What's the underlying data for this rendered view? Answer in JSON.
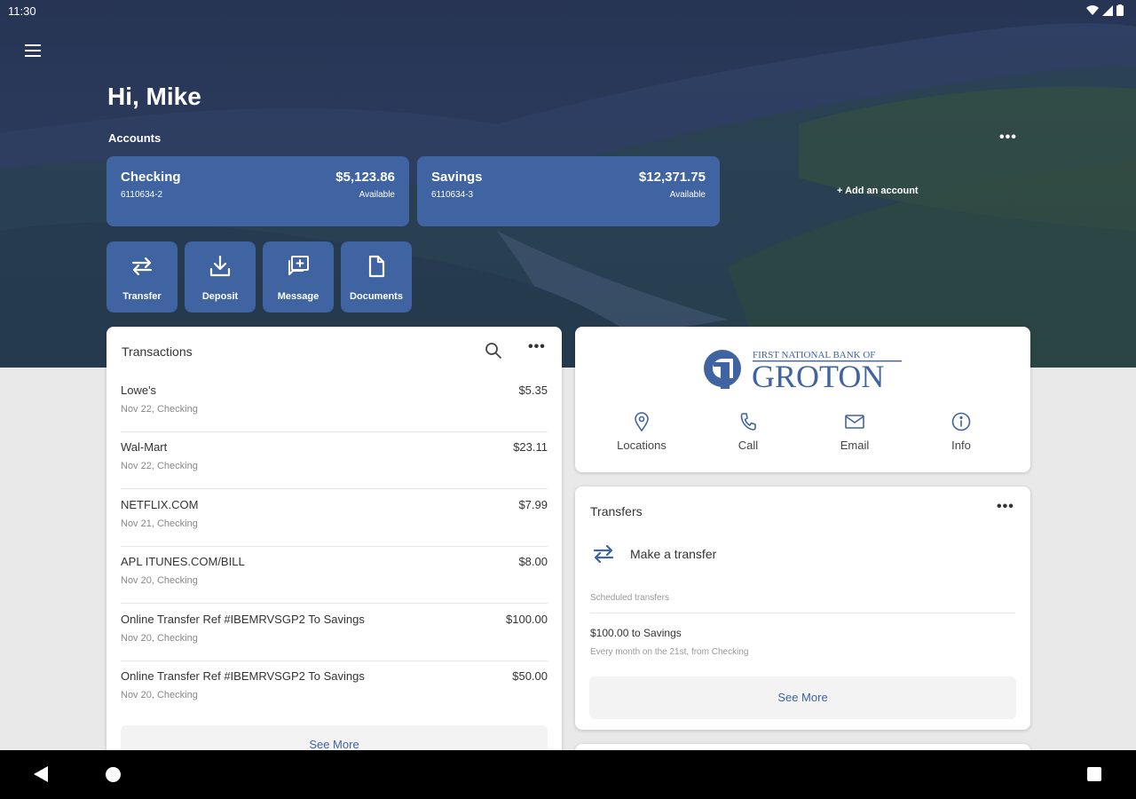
{
  "status_bar": {
    "time": "11:30"
  },
  "greeting": "Hi, Mike",
  "accounts": {
    "title": "Accounts",
    "more": "•••",
    "items": [
      {
        "name": "Checking",
        "number": "6110634-2",
        "balance": "$5,123.86",
        "balance_label": "Available"
      },
      {
        "name": "Savings",
        "number": "6110634-3",
        "balance": "$12,371.75",
        "balance_label": "Available"
      }
    ],
    "add_label": "+ Add an account"
  },
  "quick_actions": [
    {
      "label": "Transfer",
      "icon": "transfer-icon"
    },
    {
      "label": "Deposit",
      "icon": "deposit-icon"
    },
    {
      "label": "Message",
      "icon": "message-icon"
    },
    {
      "label": "Documents",
      "icon": "documents-icon"
    }
  ],
  "transactions": {
    "title": "Transactions",
    "more": "•••",
    "items": [
      {
        "desc": "Lowe's",
        "meta": "Nov 22, Checking",
        "amount": "$5.35"
      },
      {
        "desc": "Wal-Mart",
        "meta": "Nov 22, Checking",
        "amount": "$23.11"
      },
      {
        "desc": "NETFLIX.COM",
        "meta": "Nov 21, Checking",
        "amount": "$7.99"
      },
      {
        "desc": "APL ITUNES.COM/BILL",
        "meta": "Nov 20, Checking",
        "amount": "$8.00"
      },
      {
        "desc": "Online Transfer Ref #IBEMRVSGP2 To Savings",
        "meta": "Nov 20, Checking",
        "amount": "$100.00"
      },
      {
        "desc": "Online Transfer Ref #IBEMRVSGP2 To Savings",
        "meta": "Nov 20, Checking",
        "amount": "$50.00"
      }
    ],
    "see_more": "See More"
  },
  "bank": {
    "logo_top": "FIRST NATIONAL BANK OF",
    "logo_name": "GROTON",
    "actions": [
      {
        "label": "Locations",
        "icon": "location-pin-icon"
      },
      {
        "label": "Call",
        "icon": "phone-icon"
      },
      {
        "label": "Email",
        "icon": "email-icon"
      },
      {
        "label": "Info",
        "icon": "info-icon"
      }
    ]
  },
  "transfers": {
    "title": "Transfers",
    "more": "•••",
    "make_transfer": "Make a transfer",
    "scheduled_label": "Scheduled transfers",
    "scheduled_item": "$100.00 to Savings",
    "scheduled_sub": "Every month on the 21st, from Checking",
    "see_more": "See More"
  },
  "colors": {
    "accent": "#3f64a1",
    "hero": "#2f4163"
  }
}
